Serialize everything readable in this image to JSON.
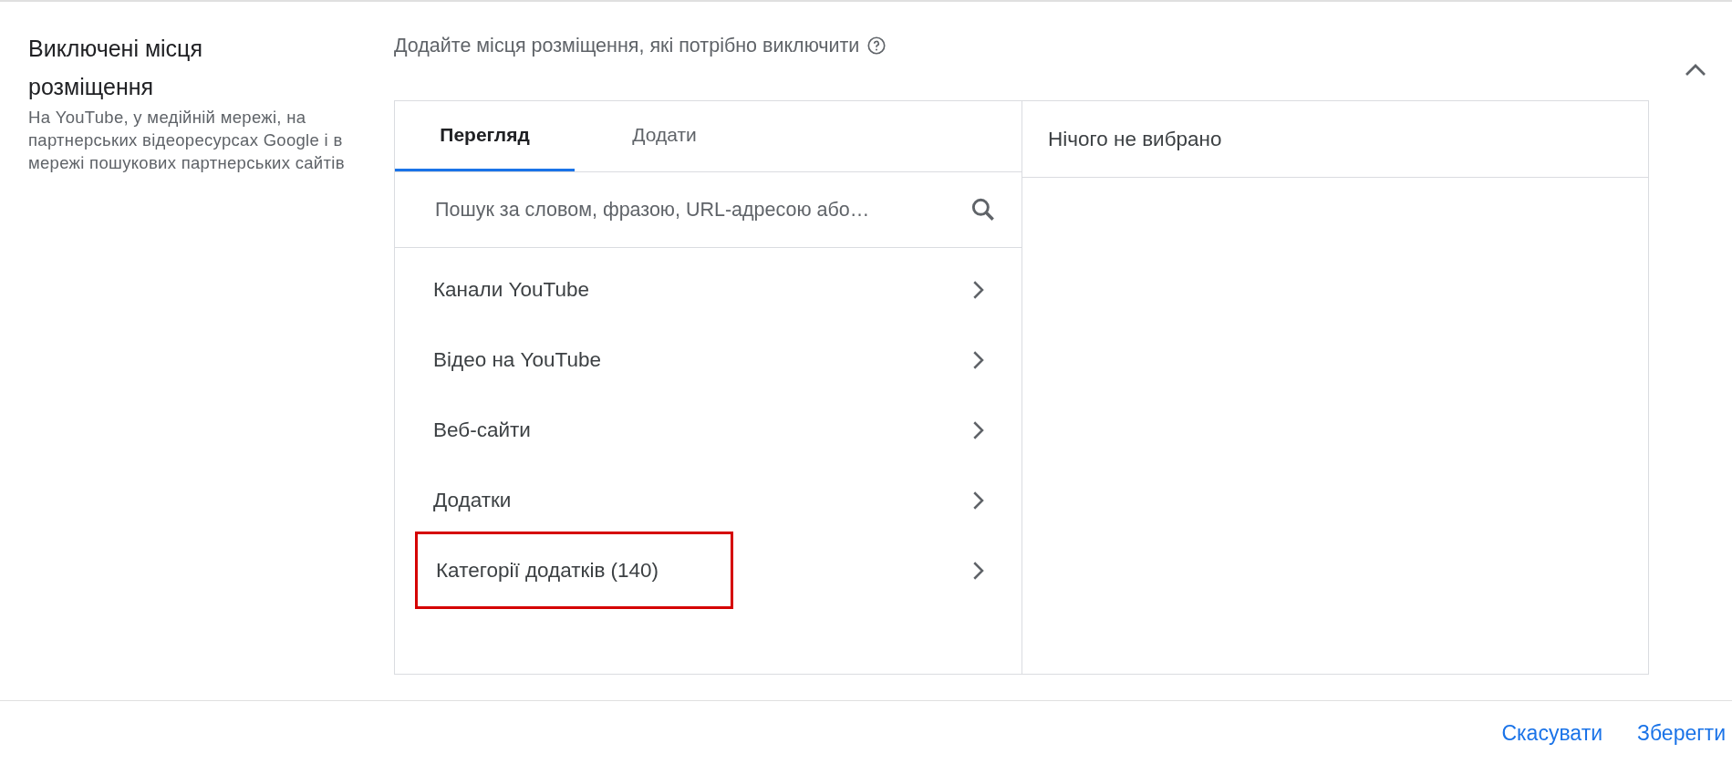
{
  "section": {
    "title": "Виключені місця розміщення",
    "description": "На YouTube, у медійній мережі, на партнерських відеоресурсах Google і в мережі пошукових партнерських сайтів",
    "expanded": true
  },
  "prompt": "Додайте місця розміщення, які потрібно виключити",
  "tabs": [
    {
      "label": "Перегляд",
      "selected": true
    },
    {
      "label": "Додати",
      "selected": false
    }
  ],
  "search": {
    "placeholder": "Пошук за словом, фразою, URL-адресою або…"
  },
  "categories": [
    {
      "label": "Канали YouTube",
      "highlighted": false
    },
    {
      "label": "Відео на YouTube",
      "highlighted": false
    },
    {
      "label": "Веб-сайти",
      "highlighted": false
    },
    {
      "label": "Додатки",
      "highlighted": false
    },
    {
      "label": "Категорії додатків (140)",
      "highlighted": true
    }
  ],
  "selection": {
    "empty_text": "Нічого не вибрано"
  },
  "buttons": [
    {
      "label": "Скасувати"
    },
    {
      "label": "Зберегти"
    }
  ]
}
